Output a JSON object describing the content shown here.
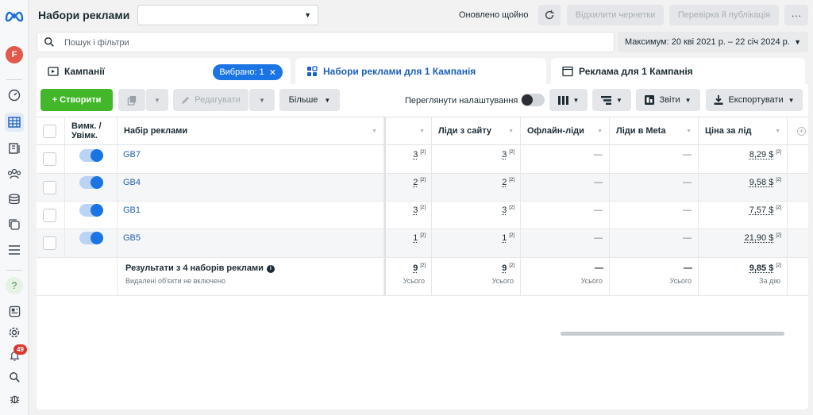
{
  "app": {
    "page_title": "Набори реклами",
    "campaign_select_value": "",
    "updated_status": "Оновлено щойно",
    "discard_drafts": "Відхилити чернетки",
    "review_publish": "Перевірка й публікація",
    "more_menu": "···"
  },
  "search": {
    "placeholder": "Пошук і фільтри",
    "date_range": "Максимум: 20 кві 2021 р. – 22 січ 2024 р."
  },
  "rail": {
    "avatar_letter": "F",
    "help_glyph": "?",
    "notifications_count": "49"
  },
  "tabs": {
    "campaigns": "Кампанії",
    "selected_chip": "Вибрано: 1",
    "adsets": "Набори реклами для 1 Кампанія",
    "ads": "Реклама для 1 Кампанія"
  },
  "toolbar": {
    "create": "+ Створити",
    "edit": "Редагувати",
    "more": "Більше",
    "view_settings": "Переглянути налаштування",
    "reports": "Звіти",
    "export": "Експортувати"
  },
  "table": {
    "headers": {
      "toggle": "Вимк. / Увімк.",
      "name": "Набір реклами",
      "results": "",
      "site_leads": "Ліди з сайту",
      "offline_leads": "Офлайн-ліди",
      "meta_leads": "Ліди в Meta",
      "cost_per_lead": "Ціна за лід"
    },
    "rows": [
      {
        "name": "GB7",
        "on": true,
        "results": "3",
        "site_leads": "3",
        "offline_leads": "—",
        "meta_leads": "—",
        "cost_per_lead": "8,29 $"
      },
      {
        "name": "GB4",
        "on": true,
        "results": "2",
        "site_leads": "2",
        "offline_leads": "—",
        "meta_leads": "—",
        "cost_per_lead": "9,58 $"
      },
      {
        "name": "GB1",
        "on": true,
        "results": "3",
        "site_leads": "3",
        "offline_leads": "—",
        "meta_leads": "—",
        "cost_per_lead": "7,57 $"
      },
      {
        "name": "GB5",
        "on": true,
        "results": "1",
        "site_leads": "1",
        "offline_leads": "—",
        "meta_leads": "—",
        "cost_per_lead": "21,90 $"
      }
    ],
    "note_marker": "[2]",
    "totals": {
      "title": "Результати з 4 наборів реклами",
      "subtitle": "Видалені об'єкти не включено",
      "results": "9",
      "site_leads": "9",
      "offline_leads": "—",
      "meta_leads": "—",
      "cost_per_lead": "9,85 $",
      "total_label": "Усього",
      "per_action_label": "За дію"
    }
  },
  "colors": {
    "primary": "#1b74e4",
    "create_green": "#42b72a",
    "link": "#2660a8"
  }
}
